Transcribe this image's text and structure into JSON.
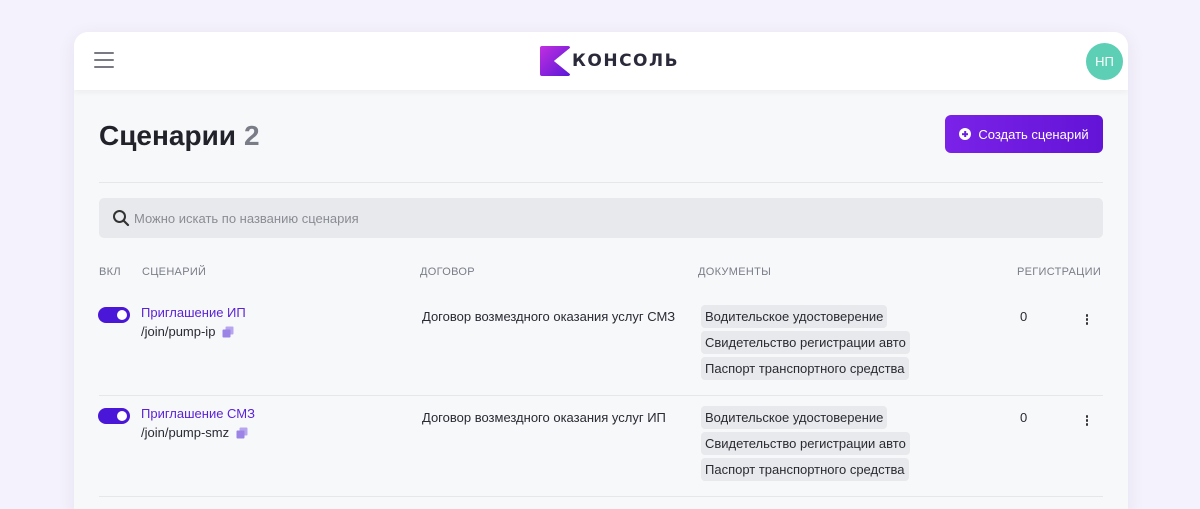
{
  "header": {
    "logo_text": "КОНСОЛЬ",
    "avatar_initials": "НП",
    "accent_color": "#6b1de0"
  },
  "page": {
    "title": "Сценарии",
    "count": "2",
    "create_button_label": "Создать сценарий"
  },
  "search": {
    "placeholder": "Можно искать по названию сценария",
    "value": ""
  },
  "table": {
    "columns": [
      "ВКЛ",
      "СЦЕНАРИЙ",
      "ДОГОВОР",
      "ДОКУМЕНТЫ",
      "РЕГИСТРАЦИИ"
    ],
    "rows": [
      {
        "enabled": true,
        "name": "Приглашение ИП",
        "path": "/join/pump-ip",
        "contract": "Договор возмездного оказания услуг СМЗ",
        "documents": [
          "Водительское удостоверение",
          "Свидетельство регистрации авто",
          "Паспорт транспортного средства"
        ],
        "registrations": "0"
      },
      {
        "enabled": true,
        "name": "Приглашение СМЗ",
        "path": "/join/pump-smz",
        "contract": "Договор возмездного оказания услуг ИП",
        "documents": [
          "Водительское удостоверение",
          "Свидетельство регистрации авто",
          "Паспорт транспортного средства"
        ],
        "registrations": "0"
      }
    ]
  }
}
